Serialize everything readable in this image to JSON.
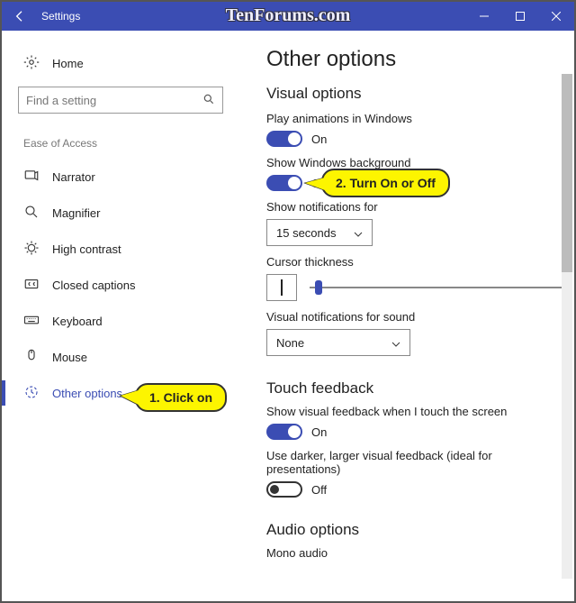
{
  "titlebar": {
    "title": "Settings"
  },
  "watermark": "TenForums.com",
  "sidebar": {
    "home": "Home",
    "search_placeholder": "Find a setting",
    "group": "Ease of Access",
    "items": [
      {
        "label": "Narrator"
      },
      {
        "label": "Magnifier"
      },
      {
        "label": "High contrast"
      },
      {
        "label": "Closed captions"
      },
      {
        "label": "Keyboard"
      },
      {
        "label": "Mouse"
      },
      {
        "label": "Other options"
      }
    ]
  },
  "content": {
    "title": "Other options",
    "visual_header": "Visual options",
    "play_anim": {
      "label": "Play animations in Windows",
      "state": "On"
    },
    "show_bg": {
      "label": "Show Windows background",
      "state": "On"
    },
    "notif_for": {
      "label": "Show notifications for",
      "value": "15 seconds"
    },
    "cursor": {
      "label": "Cursor thickness"
    },
    "visual_notif": {
      "label": "Visual notifications for sound",
      "value": "None"
    },
    "touch_header": "Touch feedback",
    "touch_feedback": {
      "label": "Show visual feedback when I touch the screen",
      "state": "On"
    },
    "darker": {
      "label": "Use darker, larger visual feedback (ideal for presentations)",
      "state": "Off"
    },
    "audio_header": "Audio options",
    "mono": {
      "label": "Mono audio"
    }
  },
  "callouts": {
    "c1": "1. Click on",
    "c2": "2. Turn On or Off"
  }
}
